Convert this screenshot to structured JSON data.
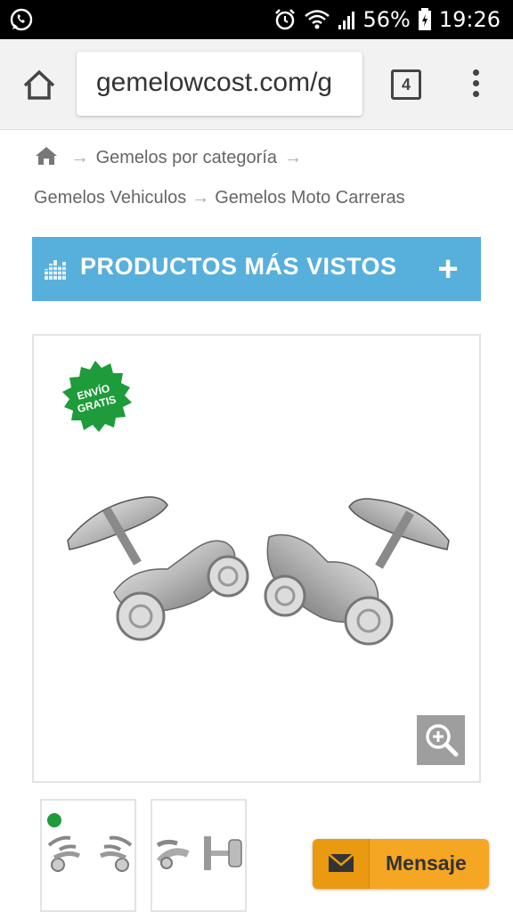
{
  "status_bar": {
    "battery": "56%",
    "time": "19:26",
    "icons": [
      "whatsapp-icon",
      "alarm-icon",
      "wifi-icon",
      "signal-icon",
      "battery-icon"
    ]
  },
  "browser": {
    "url": "gemelowcost.com/g",
    "tab_count": "4"
  },
  "breadcrumb": {
    "items": [
      "Gemelos por categoría",
      "Gemelos Vehiculos",
      "Gemelos Moto Carreras"
    ],
    "separator": "→"
  },
  "promo": {
    "title": "PRODUCTOS MÁS VISTOS",
    "color": "#57afdc"
  },
  "product": {
    "badge_line1": "ENVÍO",
    "badge_line2": "GRATIS",
    "badge_color": "#1e9b3a"
  },
  "message_button": {
    "label": "Mensaje",
    "color": "#f5a623"
  }
}
